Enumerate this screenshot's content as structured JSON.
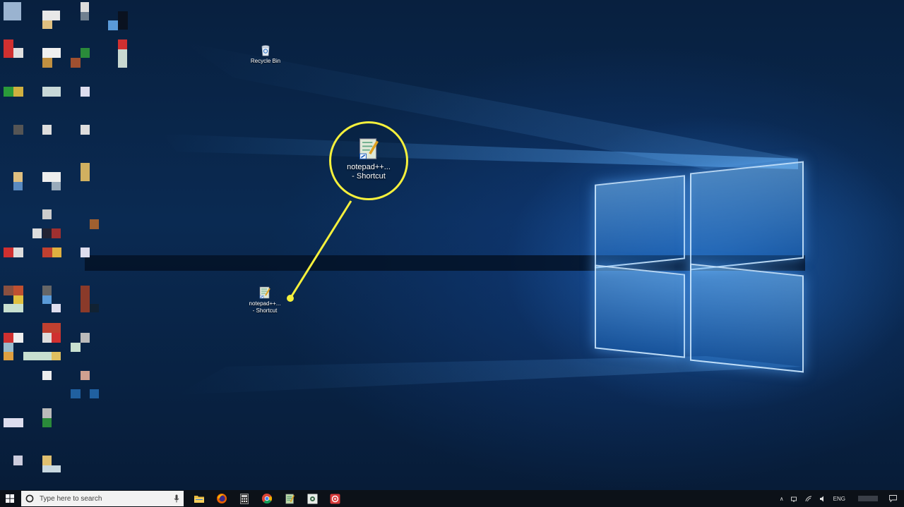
{
  "desktop": {
    "icons": {
      "recycle_bin": {
        "label": "Recycle Bin",
        "icon": "recycle-bin-icon"
      },
      "notepad_shortcut": {
        "label_line1": "notepad++...",
        "label_line2": "- Shortcut",
        "icon": "notepad-plus-plus-icon"
      }
    },
    "callout": {
      "label_line1": "notepad++...",
      "label_line2": "- Shortcut",
      "color": "#f5f03c"
    }
  },
  "taskbar": {
    "search": {
      "placeholder": "Type here to search"
    },
    "pinned_apps": [
      "file-explorer-icon",
      "firefox-icon",
      "calculator-icon",
      "chrome-icon",
      "notepad-plus-plus-icon",
      "photos-icon",
      "media-app-icon"
    ],
    "tray": {
      "language": "ENG"
    }
  },
  "colors": {
    "wallpaper_dark": "#071a33",
    "wallpaper_glow": "#2878d2",
    "taskbar_bg": "#0c1118",
    "highlight": "#f5f03c"
  }
}
